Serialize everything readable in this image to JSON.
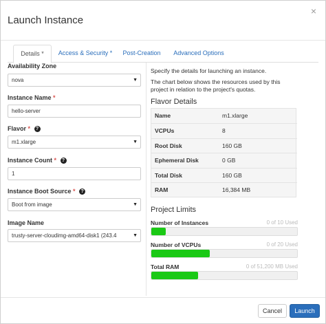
{
  "modal": {
    "title": "Launch Instance",
    "close_glyph": "×"
  },
  "tabs": [
    {
      "label": "Details *",
      "active": true
    },
    {
      "label": "Access & Security *",
      "active": false
    },
    {
      "label": "Post-Creation",
      "active": false
    },
    {
      "label": "Advanced Options",
      "active": false
    }
  ],
  "form": {
    "availability_zone": {
      "label": "Availability Zone",
      "value": "nova"
    },
    "instance_name": {
      "label": "Instance Name",
      "required": "*",
      "value": "hello-server"
    },
    "flavor": {
      "label": "Flavor",
      "required": "*",
      "value": "m1.xlarge"
    },
    "instance_count": {
      "label": "Instance Count",
      "required": "*",
      "value": "1"
    },
    "boot_source": {
      "label": "Instance Boot Source",
      "required": "*",
      "value": "Boot from image"
    },
    "image_name": {
      "label": "Image Name",
      "value": "trusty-server-cloudimg-amd64-disk1 (243.4"
    },
    "help_glyph": "?",
    "caret_glyph": "▼"
  },
  "info": {
    "intro": "Specify the details for launching an instance.",
    "chart_note": "The chart below shows the resources used by this project in relation to the project's quotas.",
    "flavor_details_title": "Flavor Details",
    "flavor_details": [
      {
        "key": "Name",
        "value": "m1.xlarge"
      },
      {
        "key": "VCPUs",
        "value": "8"
      },
      {
        "key": "Root Disk",
        "value": "160 GB"
      },
      {
        "key": "Ephemeral Disk",
        "value": "0 GB"
      },
      {
        "key": "Total Disk",
        "value": "160 GB"
      },
      {
        "key": "RAM",
        "value": "16,384 MB"
      }
    ],
    "project_limits_title": "Project Limits",
    "limits": [
      {
        "label": "Number of Instances",
        "used_text": "0 of 10 Used",
        "fill_fraction": 0.1
      },
      {
        "label": "Number of VCPUs",
        "used_text": "0 of 20 Used",
        "fill_fraction": 0.4
      },
      {
        "label": "Total RAM",
        "used_text": "0 of 51,200 MB Used",
        "fill_fraction": 0.32
      }
    ],
    "bar_color": "#1ac915"
  },
  "footer": {
    "cancel_label": "Cancel",
    "launch_label": "Launch"
  },
  "colors": {
    "primary": "#2a6ebb",
    "required": "#d9534f",
    "progress": "#1ac915"
  }
}
